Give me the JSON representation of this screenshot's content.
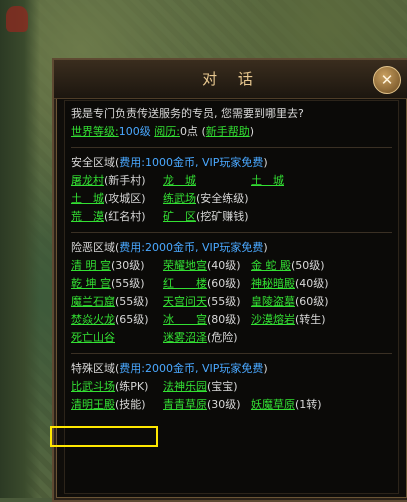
{
  "dialog": {
    "title": "对 话",
    "intro": "我是专门负责传送服务的专员, 您需要到哪里去?",
    "world_level_label": "世界等级:",
    "world_level_value": "100级",
    "history_label": "阅历:",
    "history_value": "0点",
    "help_link": "新手帮助"
  },
  "sections": [
    {
      "heading_name": "安全区域(",
      "heading_fee": "费用:1000金币, VIP玩家免费",
      "heading_close": ")",
      "rows": [
        [
          {
            "link": "屠龙村",
            "note": "(新手村)"
          },
          {
            "link": "龙　城",
            "note": ""
          },
          {
            "link": "土　城",
            "note": ""
          }
        ],
        [
          {
            "link": "土　城",
            "note": "(攻城区)"
          },
          {
            "link": "练武场",
            "note": "(安全练级)"
          },
          null
        ],
        [
          {
            "link": "荒　漠",
            "note": "(红名村)"
          },
          {
            "link": "矿　区",
            "note": "(挖矿赚钱)"
          },
          null
        ]
      ]
    },
    {
      "heading_name": "险恶区域(",
      "heading_fee": "费用:2000金币, VIP玩家免费",
      "heading_close": ")",
      "rows": [
        [
          {
            "link": "清 明 宫",
            "note": "(30级)"
          },
          {
            "link": "荣耀地宫",
            "note": "(40级)"
          },
          {
            "link": "金 蛇 殿",
            "note": "(50级)"
          }
        ],
        [
          {
            "link": "乾 坤 宫",
            "note": "(55级)"
          },
          {
            "link": "红　　楼",
            "note": "(60级)"
          },
          {
            "link": "神秘暗殿",
            "note": "(40级)"
          }
        ],
        [
          {
            "link": "魔兰石窟",
            "note": "(55级)"
          },
          {
            "link": "天宫问天",
            "note": "(55级)"
          },
          {
            "link": "皇陵盗墓",
            "note": "(60级)"
          }
        ],
        [
          {
            "link": "焚焱火龙",
            "note": "(65级)"
          },
          {
            "link": "冰　　宫",
            "note": "(80级)"
          },
          {
            "link": "沙漠熔岩",
            "note": "(转生)"
          }
        ],
        [
          {
            "link": "死亡山谷",
            "note": ""
          },
          {
            "link": "迷雾沼泽",
            "note": "(危险)"
          },
          null
        ]
      ]
    },
    {
      "heading_name": "特殊区域(",
      "heading_fee": "费用:2000金币, VIP玩家免费",
      "heading_close": ")",
      "rows": [
        [
          {
            "link": "比武斗场",
            "note": "(练PK)"
          },
          {
            "link": "法神乐园",
            "note": "(宝宝)"
          },
          null
        ],
        [
          {
            "link": "清明王殿",
            "note": "(技能)"
          },
          {
            "link": "青青草原",
            "note": "(30级)"
          },
          {
            "link": "妖魔草原",
            "note": "(1转)"
          }
        ]
      ]
    }
  ],
  "colors": {
    "link": "#33e033",
    "fee": "#4aa8ff",
    "text": "#d8d8d8",
    "highlight": "#ffe800"
  }
}
